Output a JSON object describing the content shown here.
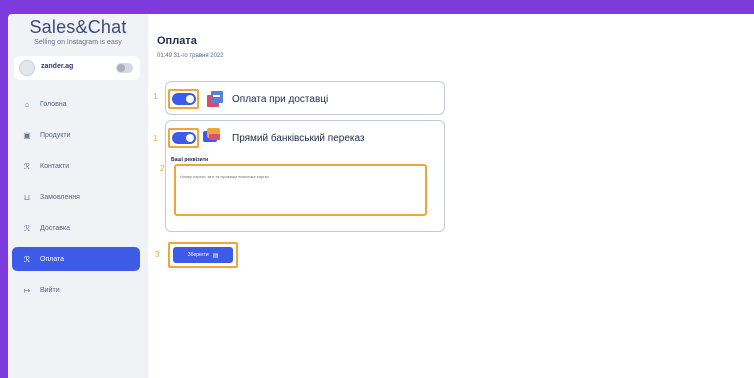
{
  "app": {
    "logo_title": "Sales&Chat",
    "logo_subtitle": "Selling on Instagram is easy"
  },
  "user": {
    "name": "zander.ag"
  },
  "sidebar": {
    "items": [
      {
        "label": "Головна",
        "icon": "home-icon"
      },
      {
        "label": "Продукти",
        "icon": "products-icon"
      },
      {
        "label": "Контакти",
        "icon": "contacts-icon"
      },
      {
        "label": "Замовлення",
        "icon": "cart-icon"
      },
      {
        "label": "Доставка",
        "icon": "delivery-icon"
      },
      {
        "label": "Оплата",
        "icon": "payment-icon",
        "active": true
      },
      {
        "label": "Вийти",
        "icon": "logout-icon"
      }
    ]
  },
  "page": {
    "title": "Оплата",
    "date": "01:49 31-го травня 2022"
  },
  "payments": {
    "cod": {
      "label": "Оплата при доставці",
      "enabled": true
    },
    "bank": {
      "label": "Прямий банківський переказ",
      "enabled": true
    },
    "requisites_label": "Ваші реквізити",
    "requisites_placeholder": "Номер картки, ім'я та прізвище власника картки"
  },
  "annotations": {
    "one_a": "1",
    "one_b": "1",
    "two": "2",
    "three": "3"
  },
  "actions": {
    "save_label": "Зберегти"
  },
  "colors": {
    "accent": "#3d5be6",
    "background": "#7d3bdc",
    "highlight": "#f0a43a"
  }
}
